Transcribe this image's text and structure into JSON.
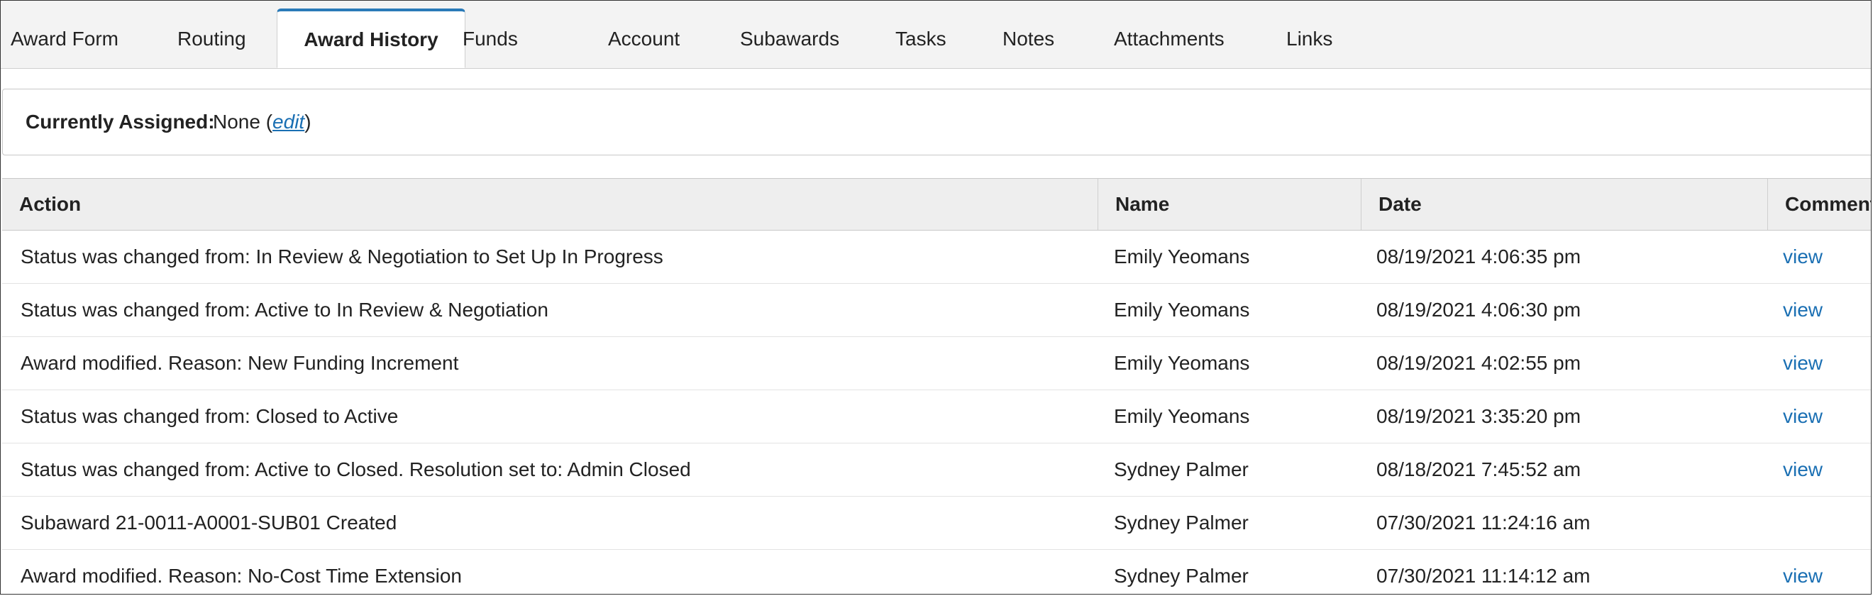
{
  "tabs": [
    {
      "label": "Award Form",
      "active": false
    },
    {
      "label": "Routing",
      "active": false
    },
    {
      "label": "Award History",
      "active": true
    },
    {
      "label": "Funds",
      "active": false
    },
    {
      "label": "Account",
      "active": false
    },
    {
      "label": "Subawards",
      "active": false
    },
    {
      "label": "Tasks",
      "active": false
    },
    {
      "label": "Notes",
      "active": false
    },
    {
      "label": "Attachments",
      "active": false
    },
    {
      "label": "Links",
      "active": false
    }
  ],
  "assigned": {
    "label": "Currently Assigned:",
    "value": "None",
    "edit_label": "edit"
  },
  "table": {
    "columns": [
      "Action",
      "Name",
      "Date",
      "Comment"
    ],
    "rows": [
      {
        "action": "Status was changed from: In Review & Negotiation to Set Up In Progress",
        "name": "Emily Yeomans",
        "date": "08/19/2021 4:06:35 pm",
        "comment": "view"
      },
      {
        "action": "Status was changed from: Active to In Review & Negotiation",
        "name": "Emily Yeomans",
        "date": "08/19/2021 4:06:30 pm",
        "comment": "view"
      },
      {
        "action": "Award modified. Reason: New Funding Increment",
        "name": "Emily Yeomans",
        "date": "08/19/2021 4:02:55 pm",
        "comment": "view"
      },
      {
        "action": "Status was changed from: Closed to Active",
        "name": "Emily Yeomans",
        "date": "08/19/2021 3:35:20 pm",
        "comment": "view"
      },
      {
        "action": "Status was changed from: Active to Closed. Resolution set to: Admin Closed",
        "name": "Sydney Palmer",
        "date": "08/18/2021 7:45:52 am",
        "comment": "view"
      },
      {
        "action": "Subaward 21-0011-A0001-SUB01 Created",
        "name": "Sydney Palmer",
        "date": "07/30/2021 11:24:16 am",
        "comment": ""
      },
      {
        "action": "Award modified. Reason: No-Cost Time Extension",
        "name": "Sydney Palmer",
        "date": "07/30/2021 11:14:12 am",
        "comment": "view"
      }
    ]
  },
  "colors": {
    "accent": "#2a7ab8",
    "link": "#1a6fb3"
  }
}
